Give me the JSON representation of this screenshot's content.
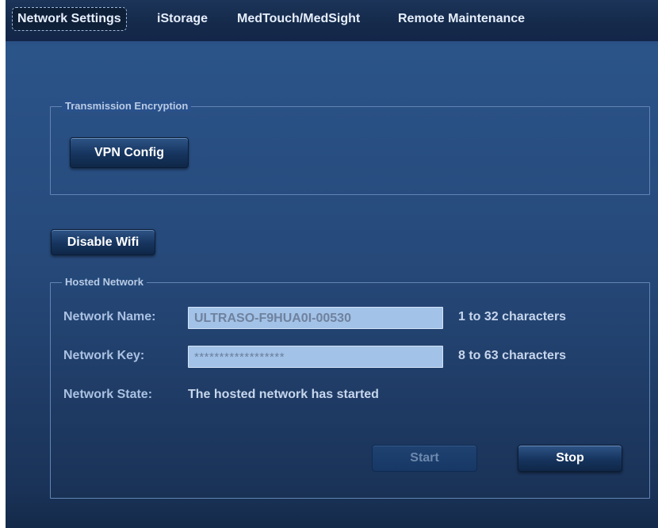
{
  "tabs": [
    {
      "label": "Network Settings",
      "active": true
    },
    {
      "label": "iStorage",
      "active": false
    },
    {
      "label": "MedTouch/MedSight",
      "active": false
    },
    {
      "label": "Remote Maintenance",
      "active": false
    }
  ],
  "transmission_encryption": {
    "title": "Transmission Encryption",
    "vpn_config_label": "VPN Config"
  },
  "wifi": {
    "disable_label": "Disable Wifi"
  },
  "hosted_network": {
    "title": "Hosted Network",
    "name": {
      "label": "Network Name:",
      "value": "ULTRASO-F9HUA0I-00530",
      "hint": "1 to 32 characters"
    },
    "key": {
      "label": "Network Key:",
      "value": "******************",
      "hint": "8 to 63 characters"
    },
    "state": {
      "label": "Network State:",
      "value": "The hosted network has started"
    },
    "start_label": "Start",
    "stop_label": "Stop"
  }
}
